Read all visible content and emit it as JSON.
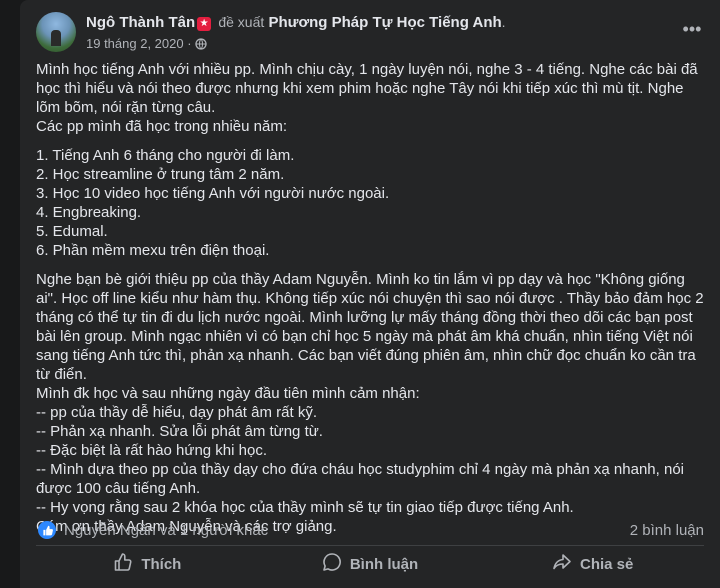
{
  "post": {
    "author": "Ngô Thành Tân",
    "suggest_text": "đề xuất",
    "group": "Phương Pháp Tự Học Tiếng Anh",
    "group_suffix": ".",
    "date": "19 tháng 2, 2020",
    "separator": "·",
    "badge_glyph": "★",
    "more_icon": "more-icon"
  },
  "content": {
    "para1": [
      "Mình học tiếng Anh với nhiều pp. Mình chịu cày, 1 ngày luyện nói, nghe 3 - 4 tiếng. Nghe các bài đã học thì hiểu và nói theo được nhưng khi xem phim hoặc nghe Tây nói khi tiếp xúc thì mù tịt. Nghe lõm bõm, nói rặn từng câu.",
      "Các pp mình đã học trong nhiều năm:"
    ],
    "list": [
      "1. Tiếng Anh 6 tháng cho người đi làm.",
      "2. Học streamline ở trung tâm 2 năm.",
      "3. Học 10 video học tiếng Anh với người nước ngoài.",
      "4. Engbreaking.",
      "5. Edumal.",
      "6. Phần mềm mexu trên điện thoại."
    ],
    "para3": [
      "Nghe bạn bè giới thiệu pp của thầy Adam Nguyễn. Mình ko tin lắm vì pp dạy và học \"Không giống ai\". Học off line kiểu như hàm thụ. Không tiếp xúc nói chuyện thì sao nói được . Thầy bảo đảm học 2 tháng có thể tự tin đi du lịch nước ngoài. Mình lưỡng lự mấy tháng đồng thời theo dõi các bạn post bài lên group. Mình ngạc nhiên vì có bạn chỉ học 5 ngày mà phát âm khá chuẩn, nhìn tiếng Việt nói sang tiếng Anh tức thì, phản xạ nhanh. Các bạn viết đúng phiên âm, nhìn chữ đọc chuẩn ko cần tra từ điển.",
      "Mình đk học và sau những ngày đầu tiên mình cảm nhận:",
      " -- pp của thầy dễ hiểu, dạy phát âm rất kỹ.",
      "-- Phản xạ nhanh. Sửa lỗi phát âm từng từ.",
      "-- Đặc biệt là rất hào hứng khi học.",
      "-- Mình dựa theo pp của thầy dạy cho đứa cháu học studyphim chỉ 4 ngày mà phản xạ nhanh, nói được 100 câu tiếng Anh.",
      "-- Hy vọng rằng sau 2 khóa học của thầy mình sẽ tự tin giao tiếp được tiếng Anh.",
      "Cám ơn thầy Adam Nguyễn và các trợ giảng."
    ]
  },
  "reactions": {
    "text": "Nguyễn Ngân và 1 người khác",
    "comments": "2 bình luận",
    "icon": "like-reaction-icon",
    "color": "#2d88ff"
  },
  "actions": {
    "like": "Thích",
    "comment": "Bình luận",
    "share": "Chia sẻ"
  },
  "colors": {
    "background": "#18191a",
    "card": "#242526",
    "text": "#e4e6eb",
    "secondary": "#b0b3b8"
  }
}
